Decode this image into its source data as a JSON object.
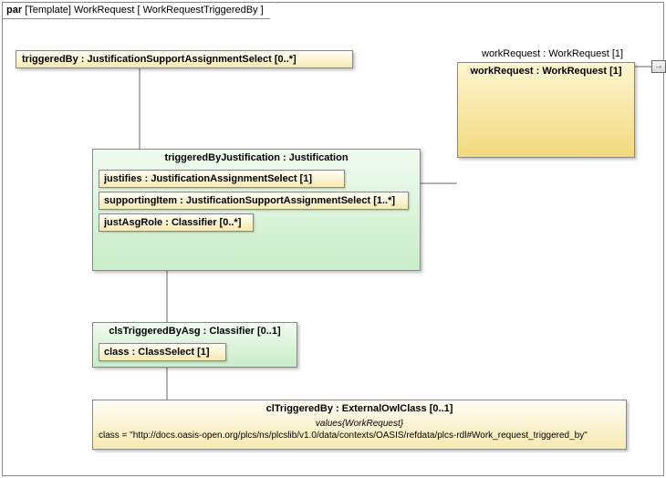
{
  "frame": {
    "kind": "par",
    "stereotype": "[Template]",
    "name": "WorkRequest",
    "context": "[ WorkRequestTriggeredBy ]"
  },
  "workRequestLabel": "workRequest : WorkRequest [1]",
  "workRequestBox": {
    "header": "workRequest : WorkRequest [1]"
  },
  "triggeredBy": {
    "header": "triggeredBy : JustificationSupportAssignmentSelect [0..*]"
  },
  "justification": {
    "header": "triggeredByJustification : Justification",
    "justifies": "justifies : JustificationAssignmentSelect [1]",
    "supportingItem": "supportingItem : JustificationSupportAssignmentSelect [1..*]",
    "justAsgRole": "justAsgRole : Classifier [0..*]"
  },
  "clsTriggeredByAsg": {
    "header": "clsTriggeredByAsg : Classifier [0..1]",
    "classRow": "class : ClassSelect [1]"
  },
  "clTriggeredBy": {
    "header": "clTriggeredBy : ExternalOwlClass [0..1]",
    "valuesLabel": "values{WorkRequest}",
    "classValue": "class = \"http://docs.oasis-open.org/plcs/ns/plcslib/v1.0/data/contexts/OASIS/refdata/plcs-rdl#Work_request_triggered_by\""
  },
  "exitGlyph": "→"
}
